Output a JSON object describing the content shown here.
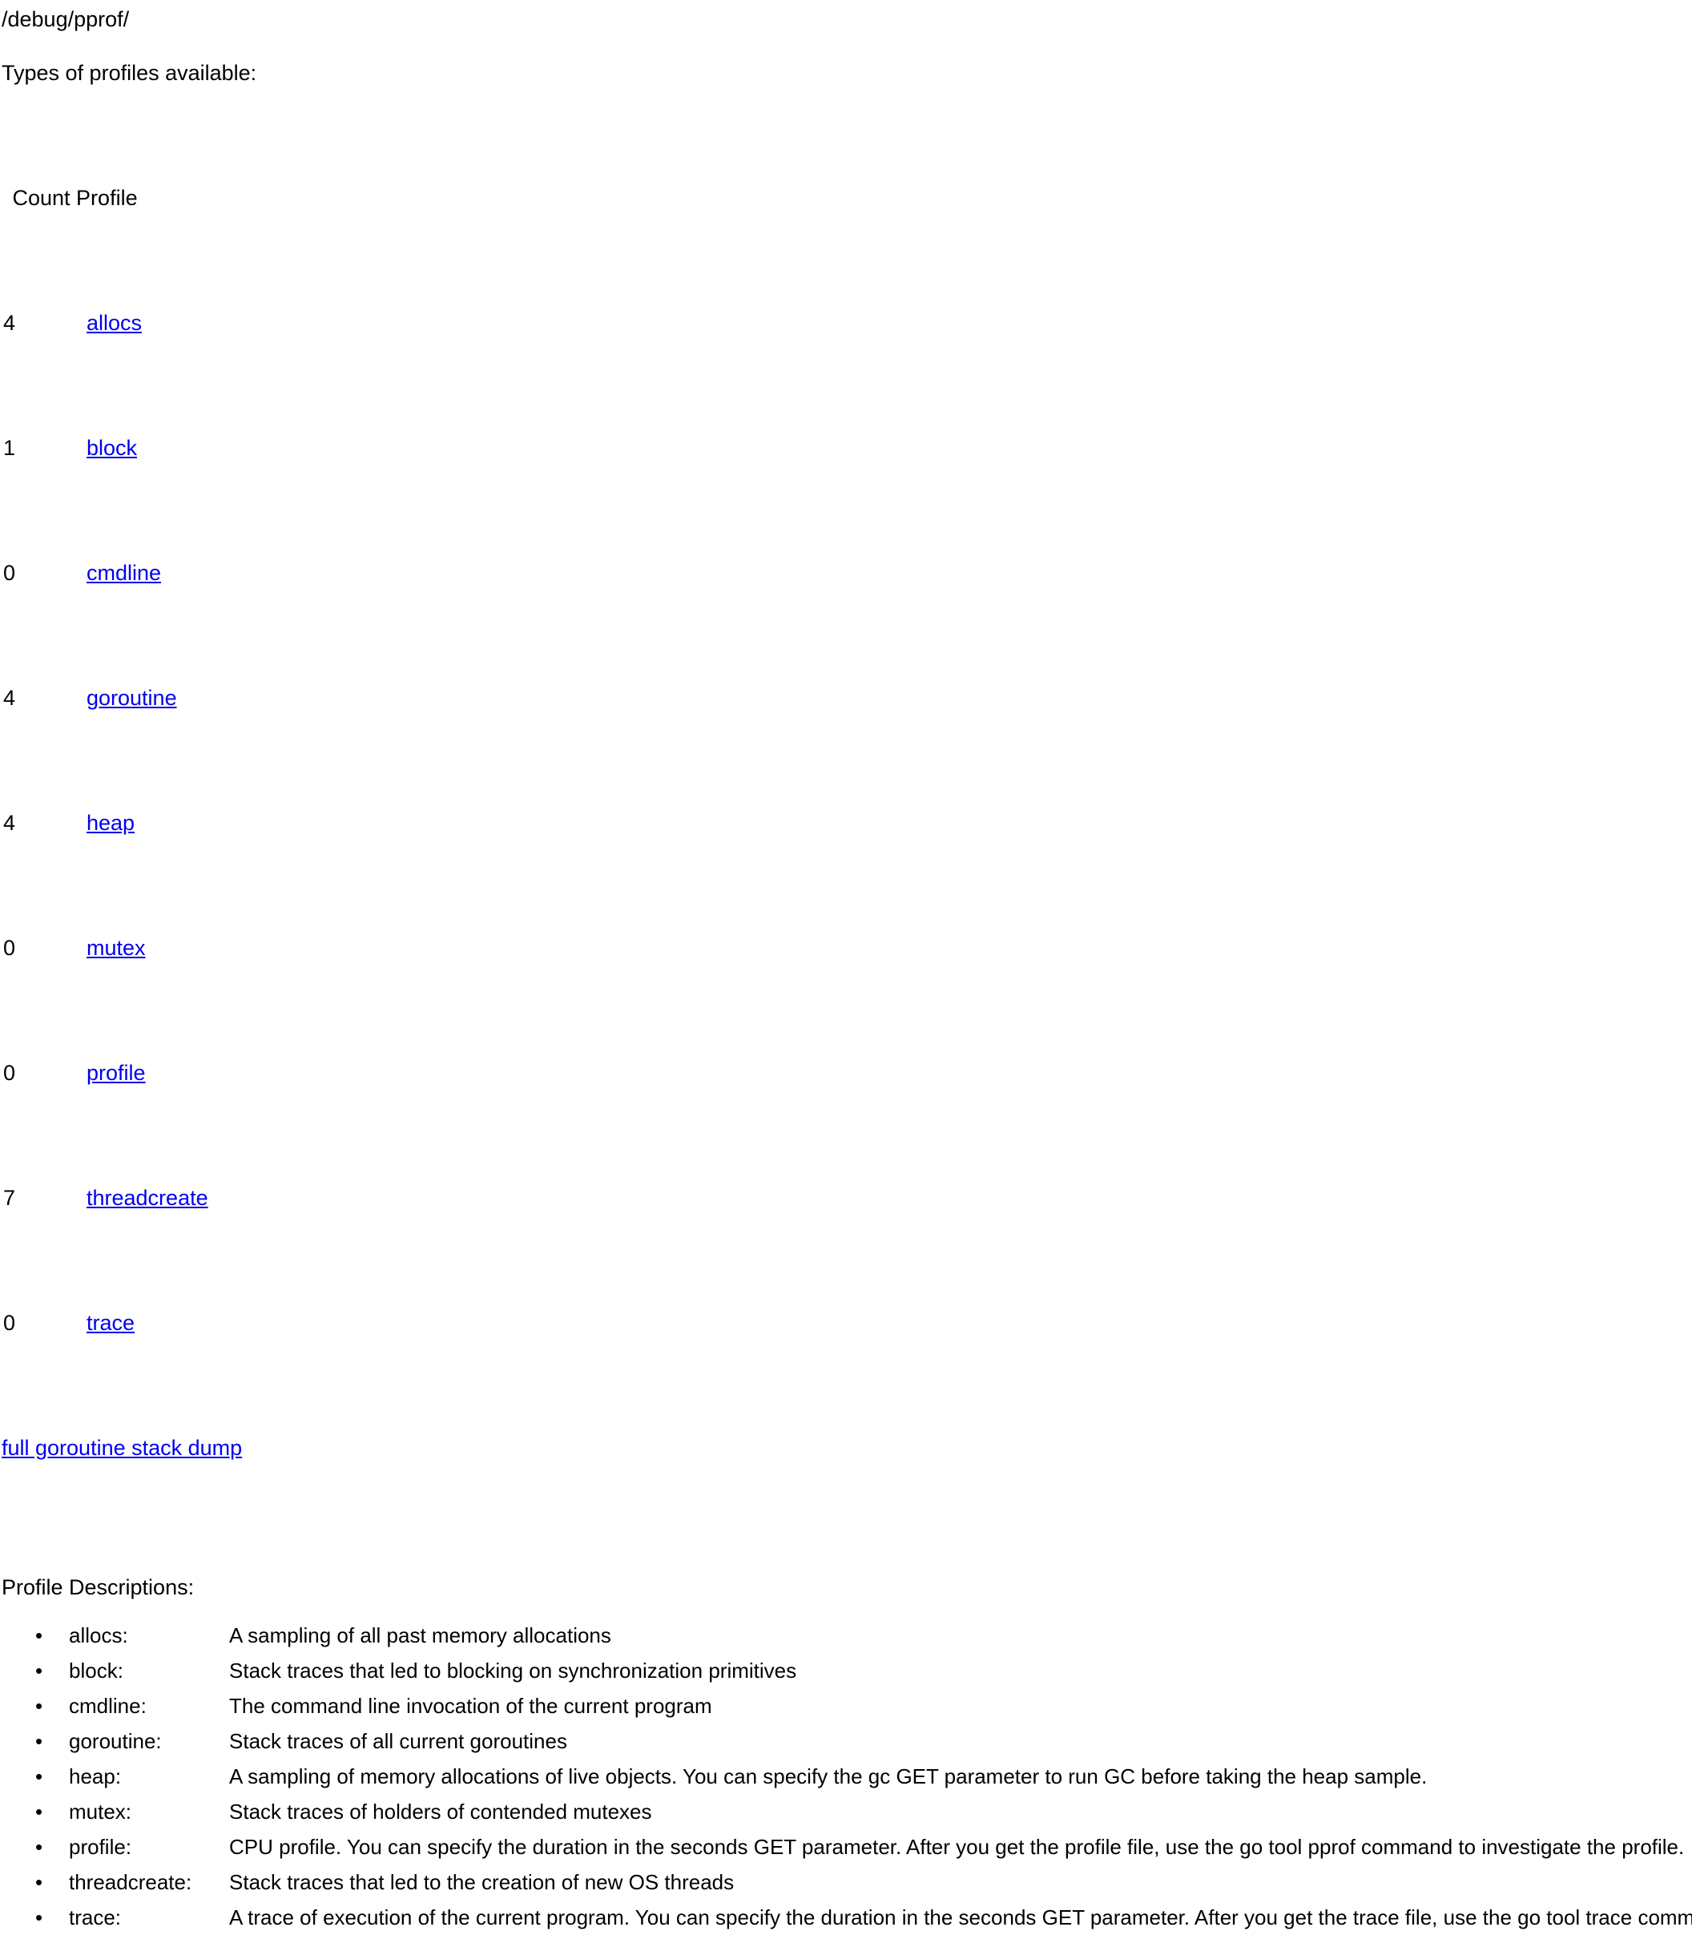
{
  "page": {
    "title": "/debug/pprof/",
    "types_heading": "Types of profiles available:",
    "descriptions_heading": "Profile Descriptions:",
    "link_color": "#0000ee",
    "text_color": "#000000",
    "background_color": "#ffffff"
  },
  "table": {
    "header": " Count Profile",
    "rows": [
      {
        "count": "4",
        "profile": "allocs"
      },
      {
        "count": "1",
        "profile": "block"
      },
      {
        "count": "0",
        "profile": "cmdline"
      },
      {
        "count": "4",
        "profile": "goroutine"
      },
      {
        "count": "4",
        "profile": "heap"
      },
      {
        "count": "0",
        "profile": "mutex"
      },
      {
        "count": "0",
        "profile": "profile"
      },
      {
        "count": "7",
        "profile": "threadcreate"
      },
      {
        "count": "0",
        "profile": "trace"
      }
    ],
    "full_dump_link": "full goroutine stack dump"
  },
  "descriptions": [
    {
      "bullet": "•",
      "label": "allocs:",
      "text": "A sampling of all past memory allocations"
    },
    {
      "bullet": "•",
      "label": "block:",
      "text": "Stack traces that led to blocking on synchronization primitives"
    },
    {
      "bullet": "•",
      "label": "cmdline:",
      "text": "The command line invocation of the current program"
    },
    {
      "bullet": "•",
      "label": "goroutine:",
      "text": "Stack traces of all current goroutines"
    },
    {
      "bullet": "•",
      "label": "heap:",
      "text": "A sampling of memory allocations of live objects. You can specify the gc GET parameter to run GC before taking the heap sample."
    },
    {
      "bullet": "•",
      "label": "mutex:",
      "text": "Stack traces of holders of contended mutexes"
    },
    {
      "bullet": "•",
      "label": "profile:",
      "text": "CPU profile. You can specify the duration in the seconds GET parameter. After you get the profile file, use the go tool pprof command to investigate the profile."
    },
    {
      "bullet": "•",
      "label": "threadcreate:",
      "text": "Stack traces that led to the creation of new OS threads"
    },
    {
      "bullet": "•",
      "label": "trace:",
      "text": "A trace of execution of the current program. You can specify the duration in the seconds GET parameter. After you get the trace file, use the go tool trace command to investigate the trace."
    }
  ]
}
